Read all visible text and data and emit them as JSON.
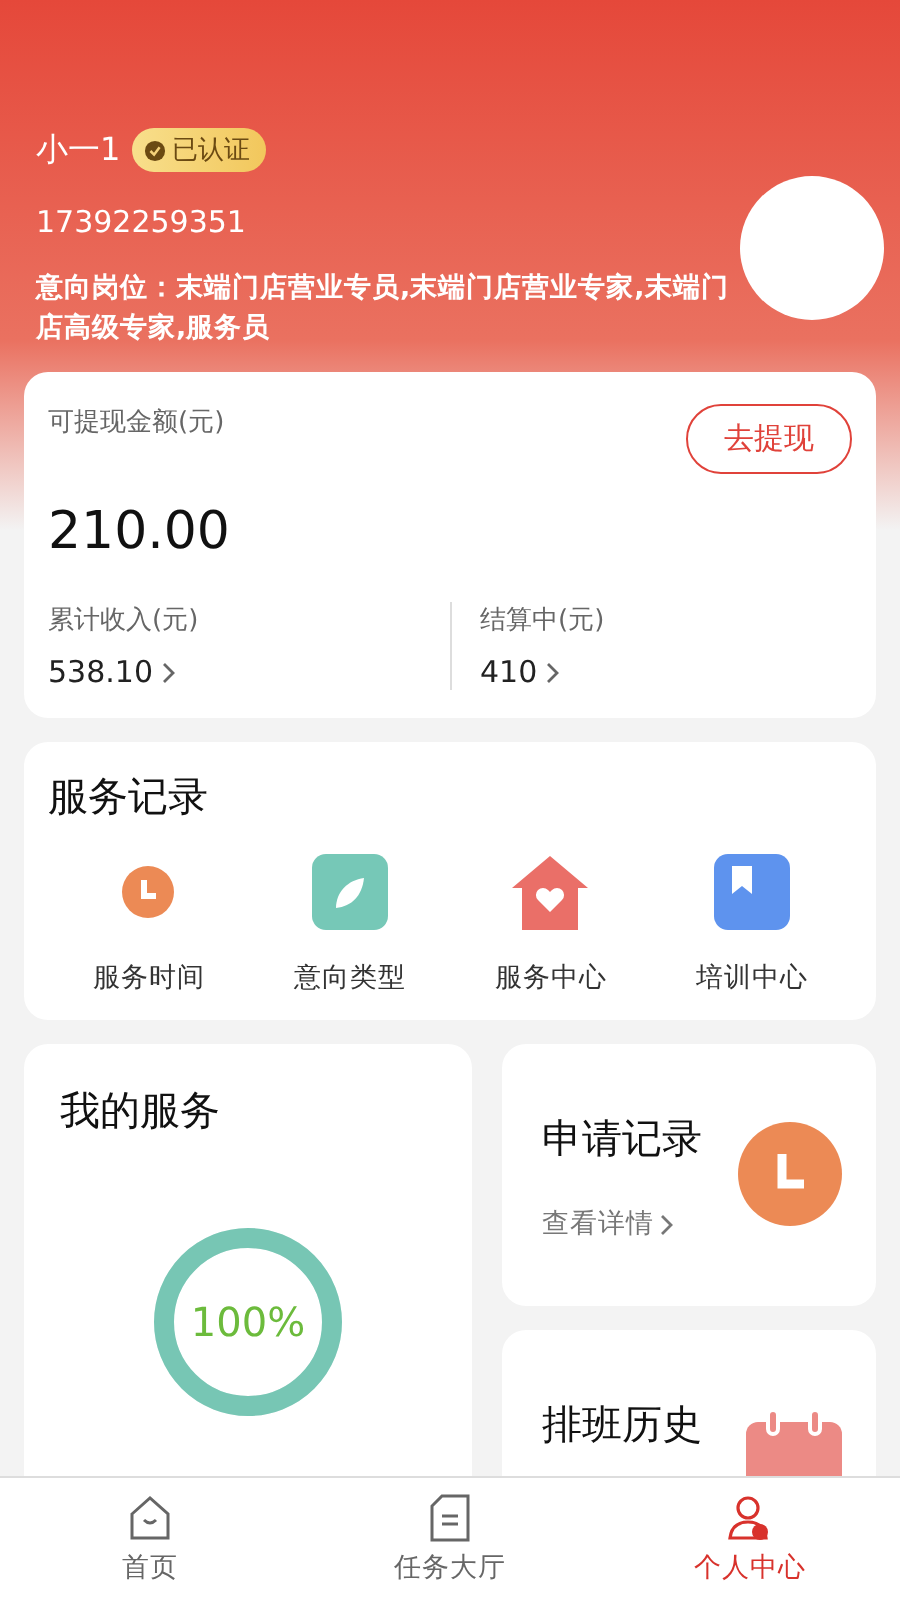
{
  "profile": {
    "name": "小一1",
    "badge": "已认证",
    "phone": "17392259351",
    "position": "意向岗位：末端门店营业专员,末端门店营业专家,末端门店高级专家,服务员"
  },
  "earnings": {
    "label": "可提现金额(元)",
    "amount": "210.00",
    "withdraw_button": "去提现",
    "stats": [
      {
        "label": "累计收入(元)",
        "value": "538.10"
      },
      {
        "label": "结算中(元)",
        "value": "410"
      }
    ]
  },
  "service_records": {
    "title": "服务记录",
    "items": [
      {
        "kind": "clock",
        "label": "服务时间"
      },
      {
        "kind": "leaf",
        "label": "意向类型"
      },
      {
        "kind": "house",
        "label": "服务中心"
      },
      {
        "kind": "book",
        "label": "培训中心"
      }
    ]
  },
  "my_service": {
    "title": "我的服务",
    "progress": {
      "level": 1,
      "reading": "100%"
    }
  },
  "side_cards": [
    {
      "kind": "clock",
      "title": "申请记录",
      "link": "查看详情"
    },
    {
      "kind": "calendar",
      "title": "排班历史"
    }
  ],
  "tab_bar": [
    {
      "kind": "home",
      "label": "首页",
      "selected": false
    },
    {
      "kind": "document",
      "label": "任务大厅",
      "selected": false
    },
    {
      "kind": "person",
      "label": "个人中心",
      "selected": true
    }
  ]
}
